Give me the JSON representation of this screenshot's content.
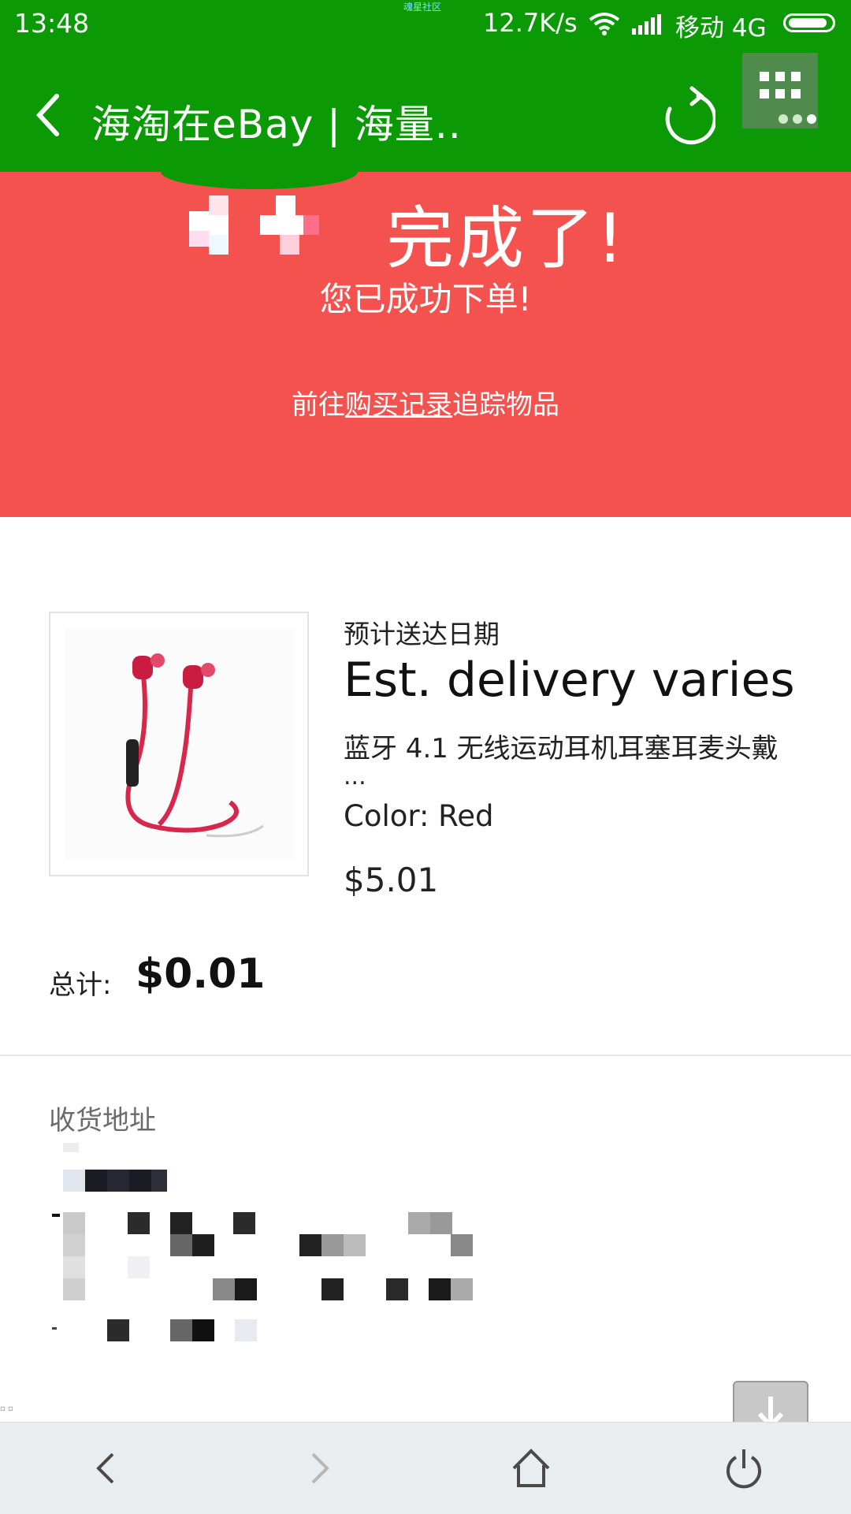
{
  "status_bar": {
    "time": "13:48",
    "notification": "魂星社区",
    "net_speed": "12.7K/s",
    "carrier": "移动 4G",
    "wifi_icon": "wifi-icon",
    "signal_icon": "cell-signal-icon",
    "battery_icon": "battery-icon"
  },
  "nav": {
    "title": "海淘在eBay | 海量..",
    "back_icon": "back-chevron-icon",
    "refresh_icon": "refresh-icon",
    "more_icon": "apps-grid-icon"
  },
  "banner": {
    "title": "完成了!",
    "subtitle": "您已成功下单!",
    "track_prefix": "前往",
    "track_link": "购买记录",
    "track_suffix": "追踪物品",
    "bg_color": "#f4524f"
  },
  "order": {
    "delivery_label": "预计送达日期",
    "delivery_value": "Est. delivery varies",
    "item_title": "蓝牙 4.1 无线运动耳机耳塞耳麦头戴",
    "item_ellipsis": "...",
    "item_color": "Color: Red",
    "item_price": "$5.01",
    "total_label": "总计:",
    "total_value": "$0.01",
    "thumb_icon": "red-earphones-image"
  },
  "shipping": {
    "label": "收货地址"
  },
  "bottom_bar": {
    "back_icon": "back-arrow-icon",
    "forward_icon": "forward-arrow-icon",
    "home_icon": "home-icon",
    "power_icon": "power-icon",
    "download_icon": "download-icon"
  },
  "colors": {
    "brand_green": "#0b9a06",
    "banner_red": "#f4524f"
  }
}
